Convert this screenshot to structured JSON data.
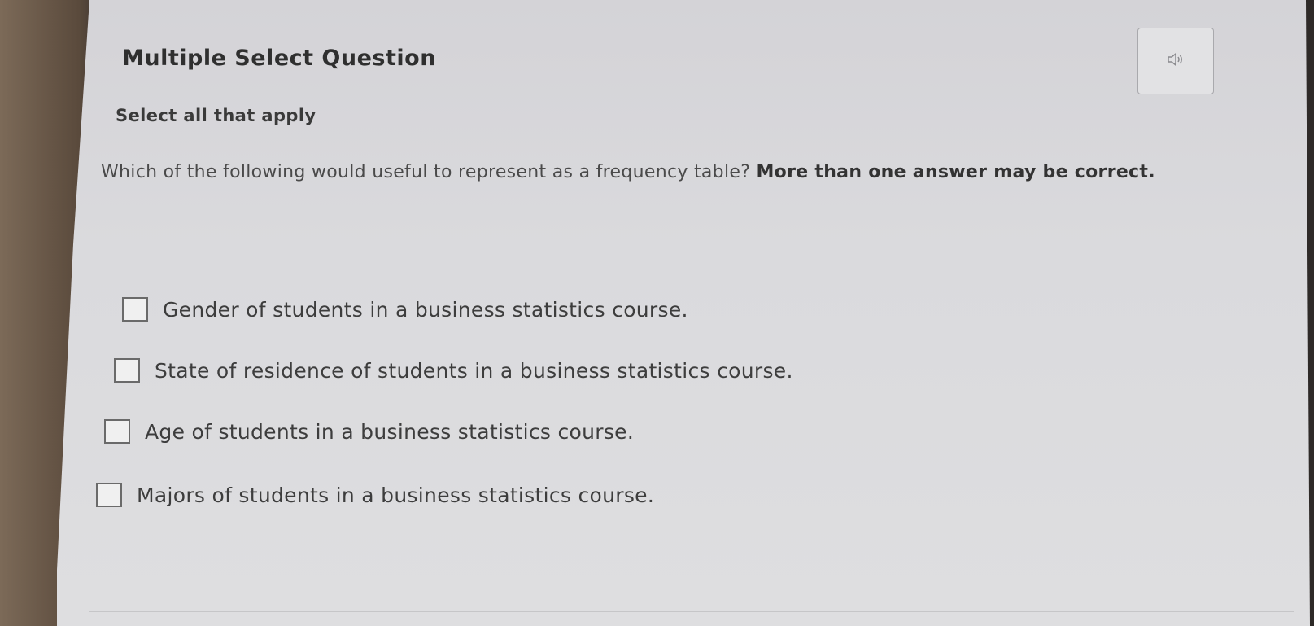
{
  "question": {
    "type_label": "Multiple Select Question",
    "instruction": "Select all that apply",
    "prompt_text": "Which of the following would useful to represent as a frequency table? ",
    "prompt_bold": "More than one answer may be correct.",
    "audio_icon": "speaker-icon"
  },
  "options": [
    {
      "label": "Gender of students in a business statistics course.",
      "checked": false
    },
    {
      "label": "State of residence of students in a business statistics course.",
      "checked": false
    },
    {
      "label": "Age of students in a business statistics course.",
      "checked": false
    },
    {
      "label": "Majors of students in a business statistics course.",
      "checked": false
    }
  ],
  "colors": {
    "background": "#dadadd",
    "text": "#3d3d3d"
  }
}
